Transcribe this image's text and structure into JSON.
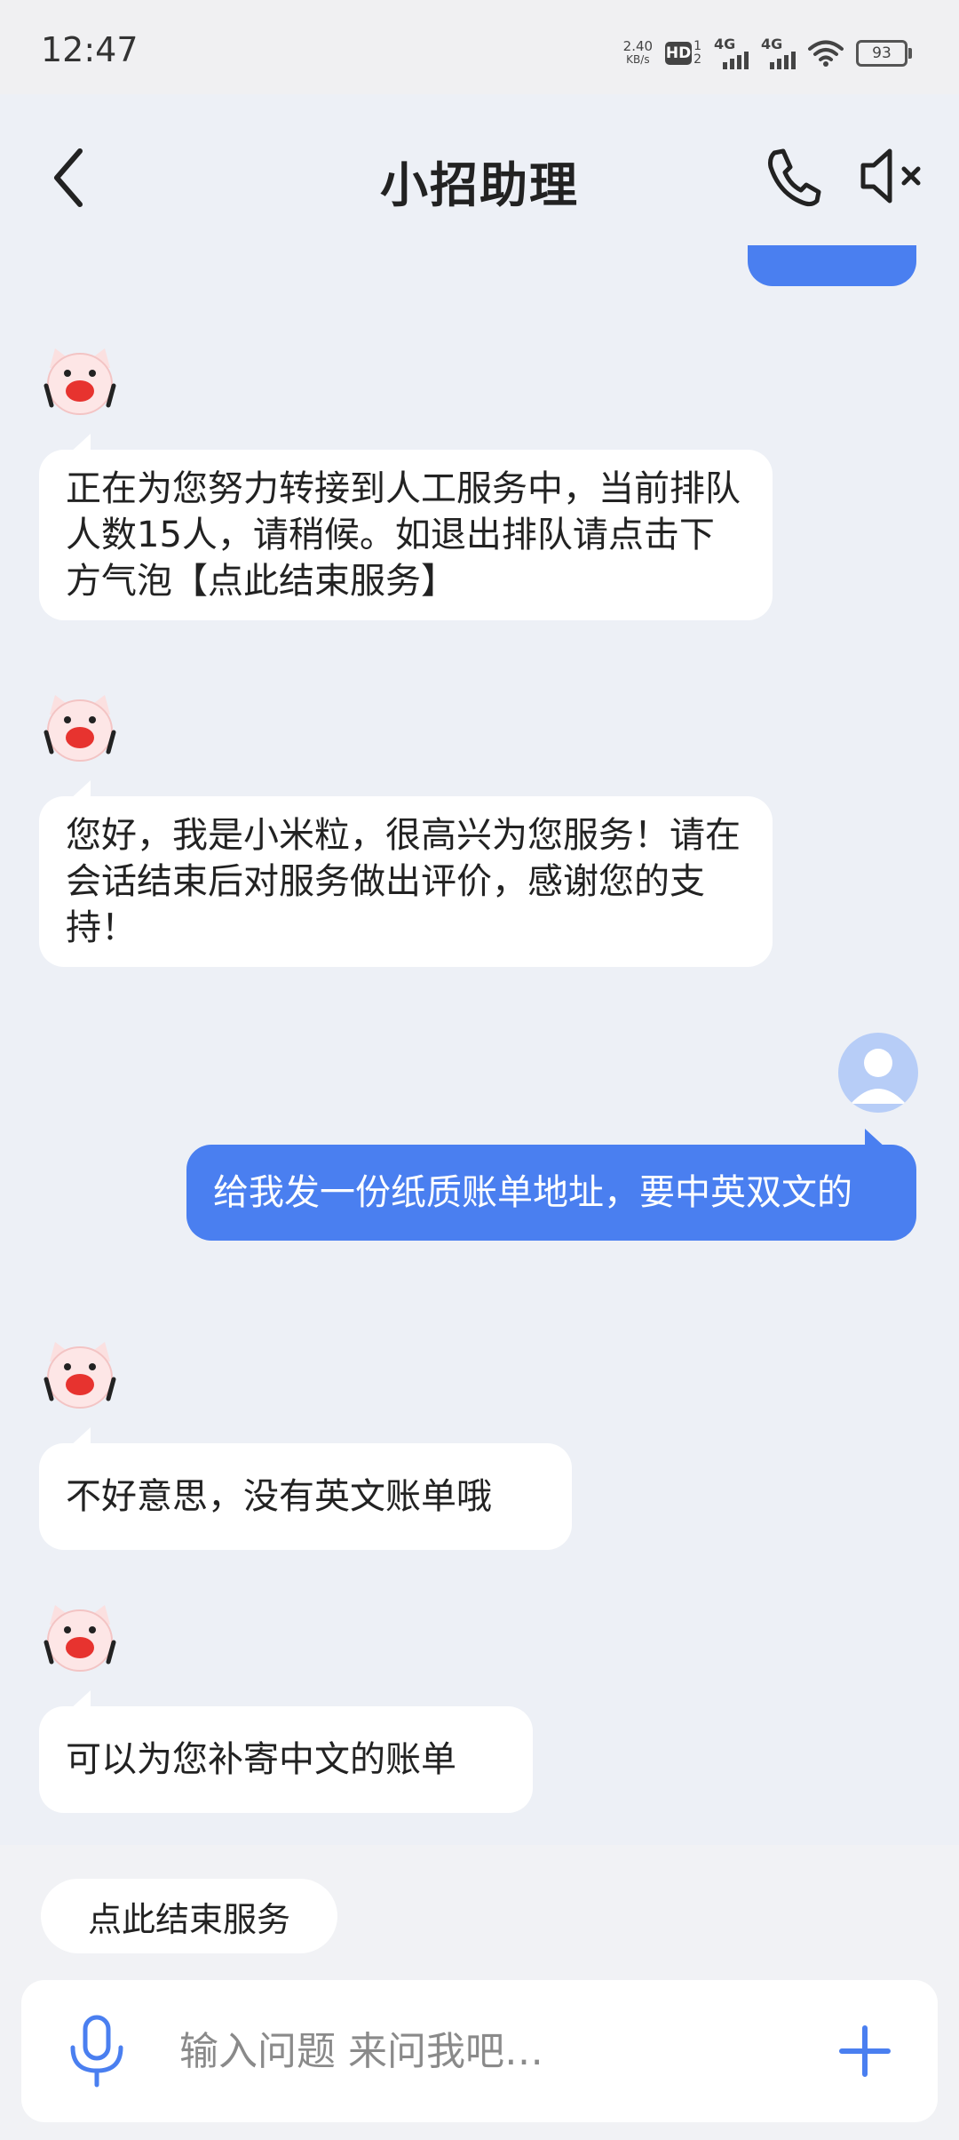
{
  "status_bar": {
    "time": "12:47",
    "net_speed": "2.40",
    "net_speed_unit": "KB/s",
    "hd_badge": "HD",
    "sim_1": "1",
    "sim_2": "2",
    "signal_1": "4G",
    "signal_2": "4G",
    "battery": "93"
  },
  "header": {
    "title": "小招助理"
  },
  "chat": {
    "messages": [
      {
        "sender": "bot",
        "text": "正在为您努力转接到人工服务中，当前排队人数15人，请稍候。如退出排队请点击下方气泡【点此结束服务】"
      },
      {
        "sender": "bot",
        "text": "您好，我是小米粒，很高兴为您服务！请在会话结束后对服务做出评价，感谢您的支持！"
      },
      {
        "sender": "user",
        "text": "给我发一份纸质账单地址，要中英双文的"
      },
      {
        "sender": "bot",
        "text": "不好意思，没有英文账单哦"
      },
      {
        "sender": "bot",
        "text": "可以为您补寄中文的账单"
      }
    ]
  },
  "quick_reply": {
    "end_service": "点此结束服务"
  },
  "input": {
    "placeholder": "输入问题 来问我吧…"
  },
  "colors": {
    "accent": "#4a7ff0",
    "background": "#edf0f6",
    "bot_bubble": "#ffffff"
  },
  "icons": [
    "back-arrow-icon",
    "phone-icon",
    "speaker-muted-icon",
    "bot-avatar-icon",
    "user-avatar-icon",
    "microphone-icon",
    "plus-icon"
  ]
}
